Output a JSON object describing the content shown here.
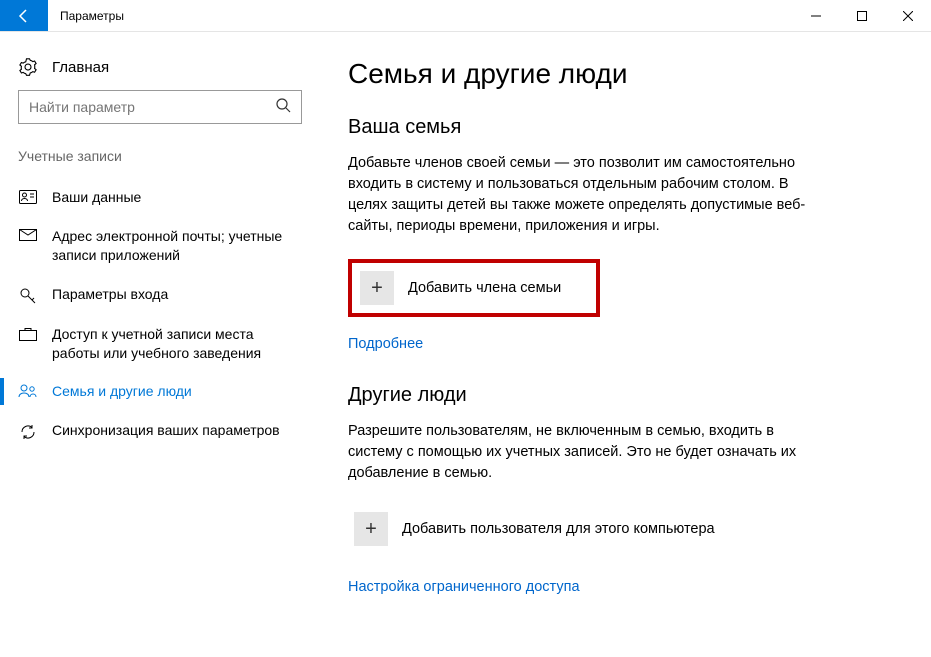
{
  "window": {
    "title": "Параметры"
  },
  "sidebar": {
    "home": "Главная",
    "search_placeholder": "Найти параметр",
    "section": "Учетные записи",
    "items": [
      {
        "label": "Ваши данные"
      },
      {
        "label": "Адрес электронной почты; учетные записи приложений"
      },
      {
        "label": "Параметры входа"
      },
      {
        "label": "Доступ к учетной записи места работы или учебного заведения"
      },
      {
        "label": "Семья и другие люди"
      },
      {
        "label": "Синхронизация ваших параметров"
      }
    ]
  },
  "main": {
    "title": "Семья и другие люди",
    "family_heading": "Ваша семья",
    "family_text": "Добавьте членов своей семьи — это позволит им самостоятельно входить в систему и пользоваться отдельным рабочим столом. В целях защиты детей вы также можете определять допустимые веб-сайты, периоды времени, приложения и игры.",
    "add_family": "Добавить члена семьи",
    "more": "Подробнее",
    "others_heading": "Другие люди",
    "others_text": "Разрешите пользователям, не включенным в семью, входить в систему с помощью их учетных записей. Это не будет означать их добавление в семью.",
    "add_other": "Добавить пользователя для этого компьютера",
    "restricted": "Настройка ограниченного доступа"
  }
}
